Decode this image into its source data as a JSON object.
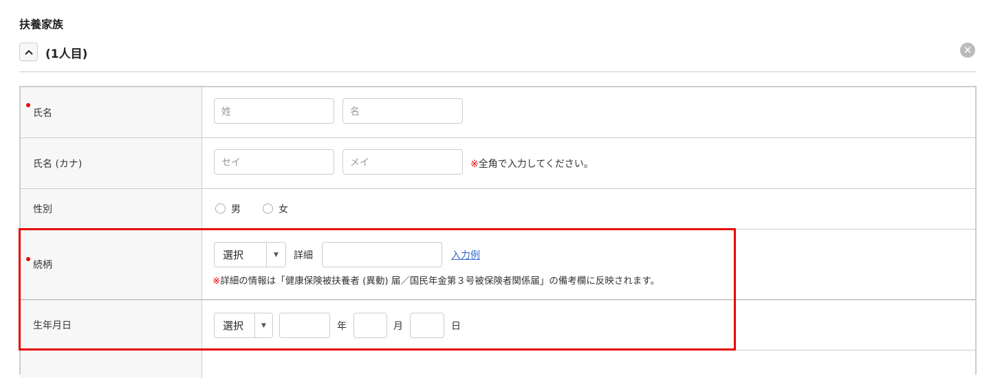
{
  "section_title": "扶養家族",
  "person_label": "(1人目)",
  "rows": {
    "name": {
      "label": "氏名",
      "last_placeholder": "姓",
      "first_placeholder": "名"
    },
    "kana": {
      "label": "氏名 (カナ)",
      "last_placeholder": "セイ",
      "first_placeholder": "メイ",
      "note_mark": "※",
      "note": "全角で入力してください。"
    },
    "gender": {
      "label": "性別",
      "options": [
        "男",
        "女"
      ]
    },
    "relation": {
      "label": "続柄",
      "select": "選択",
      "detail_label": "詳細",
      "example_link": "入力例",
      "note_mark": "※",
      "note": "詳細の情報は「健康保険被扶養者 (異動) 届／国民年金第３号被保険者関係届」の備考欄に反映されます。"
    },
    "birth": {
      "label": "生年月日",
      "select": "選択",
      "year": "年",
      "month": "月",
      "day": "日"
    }
  },
  "colors": {
    "required": "#e00000",
    "highlight": "#e60000",
    "link": "#3366cc"
  }
}
